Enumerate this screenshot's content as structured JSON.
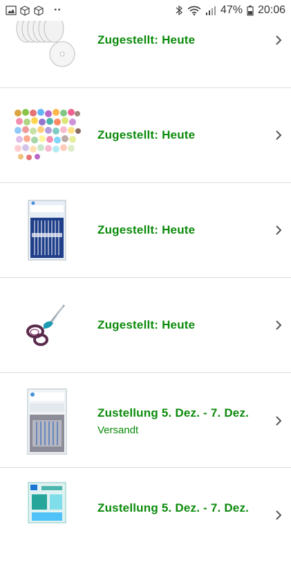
{
  "status_bar": {
    "notification_icons": [
      "image-icon",
      "box-icon",
      "box-icon"
    ],
    "more_dots": "··",
    "battery_percent": "47%",
    "time": "20:06"
  },
  "colors": {
    "delivered_green": "#0a8a0a",
    "divider": "#dddddd",
    "chevron": "#555555"
  },
  "orders": [
    {
      "product_icon": "rotary-blades-icon",
      "status": "Zugestellt: Heute",
      "subtext": ""
    },
    {
      "product_icon": "buttons-assortment-icon",
      "status": "Zugestellt: Heute",
      "subtext": ""
    },
    {
      "product_icon": "schmetz-needles-icon",
      "status": "Zugestellt: Heute",
      "subtext": ""
    },
    {
      "product_icon": "embroidery-scissors-icon",
      "status": "Zugestellt: Heute",
      "subtext": ""
    },
    {
      "product_icon": "schmetz-jersey-needles-icon",
      "status": "Zustellung 5. Dez. - 7. Dez.",
      "subtext": "Versandt"
    },
    {
      "product_icon": "prym-package-icon",
      "status": "Zustellung 5. Dez. - 7. Dez.",
      "subtext": ""
    }
  ]
}
